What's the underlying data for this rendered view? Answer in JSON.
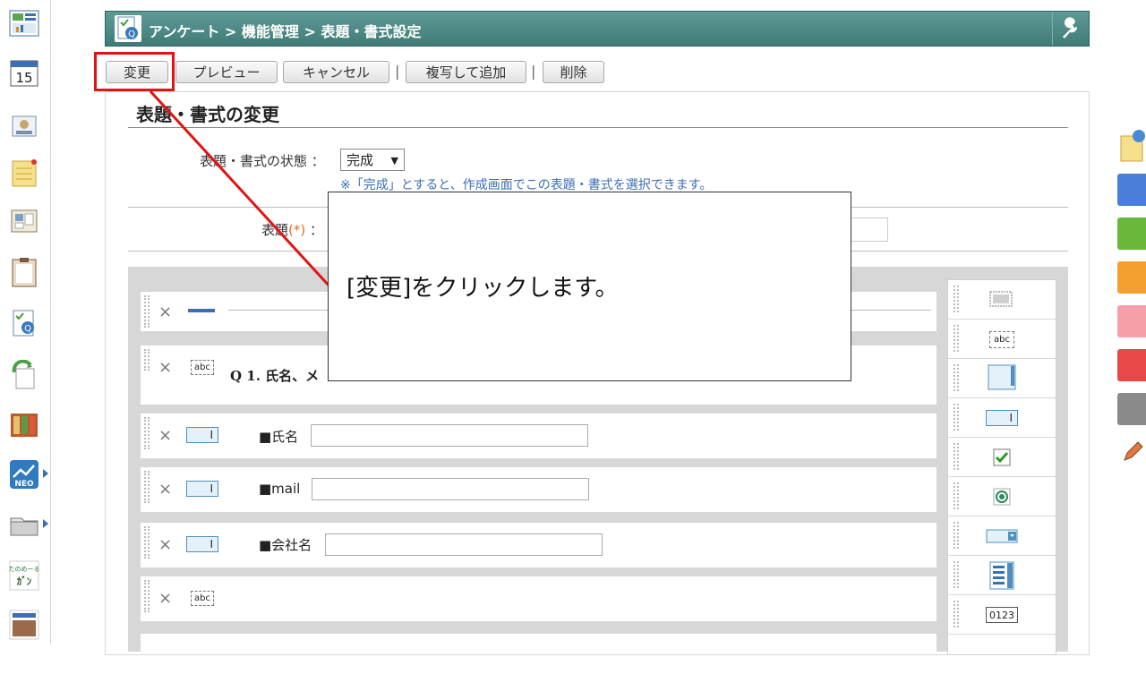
{
  "header": {
    "breadcrumb": "アンケート > 機能管理 > 表題・書式設定"
  },
  "toolbar": {
    "change_label": "変更",
    "preview_label": "プレビュー",
    "cancel_label": "キャンセル",
    "separator": "|",
    "duplicate_label": "複写して追加",
    "delete_label": "削除"
  },
  "section": {
    "title": "表題・書式の変更"
  },
  "form": {
    "status_label": "表題・書式の状態 ：",
    "status_value": "完成",
    "status_note": "※「完成」とすると、作成画面でこの表題・書式を選択できます。",
    "title_label": "表題",
    "title_required": "(*)",
    "title_colon": "："
  },
  "builder": {
    "rows": [
      {
        "type": "separator",
        "label": ""
      },
      {
        "type": "text",
        "icon_text": "abc",
        "label": "Q 1. 氏名、メ"
      },
      {
        "type": "textbox",
        "icon_text": "I",
        "label": "■氏名"
      },
      {
        "type": "textbox",
        "icon_text": "I",
        "label": "■mail"
      },
      {
        "type": "textbox",
        "icon_text": "I",
        "label": "■会社名"
      },
      {
        "type": "text",
        "icon_text": "abc",
        "label": ""
      }
    ],
    "delete_glyph": "×"
  },
  "palette": {
    "items": [
      {
        "name": "table",
        "text": ""
      },
      {
        "name": "text",
        "text": "abc"
      },
      {
        "name": "textarea",
        "text": ""
      },
      {
        "name": "textbox",
        "text": "I"
      },
      {
        "name": "checkbox",
        "text": "✔"
      },
      {
        "name": "radio",
        "text": "◉"
      },
      {
        "name": "select",
        "text": "▾"
      },
      {
        "name": "list",
        "text": ""
      },
      {
        "name": "number",
        "text": "0123"
      }
    ]
  },
  "callout": {
    "text": "[変更]をクリックします。"
  },
  "colors": {
    "header": "#4a8783",
    "highlight": "#e01414",
    "note": "#3b6eb5",
    "required": "#e07020"
  },
  "sidebar_icons": [
    "portal-icon",
    "calendar-icon",
    "facility-icon",
    "memo-icon",
    "bulletin-icon",
    "report-icon",
    "survey-icon",
    "workflow-icon",
    "cabinet-icon",
    "neo-icon",
    "folder-icon",
    "tanomeru-icon",
    "news-icon"
  ],
  "right_tabs": [
    "note-icon",
    "blue-tab",
    "green-tab",
    "orange-tab",
    "pink-tab",
    "red-tab",
    "gray-tab",
    "pencil-icon"
  ]
}
